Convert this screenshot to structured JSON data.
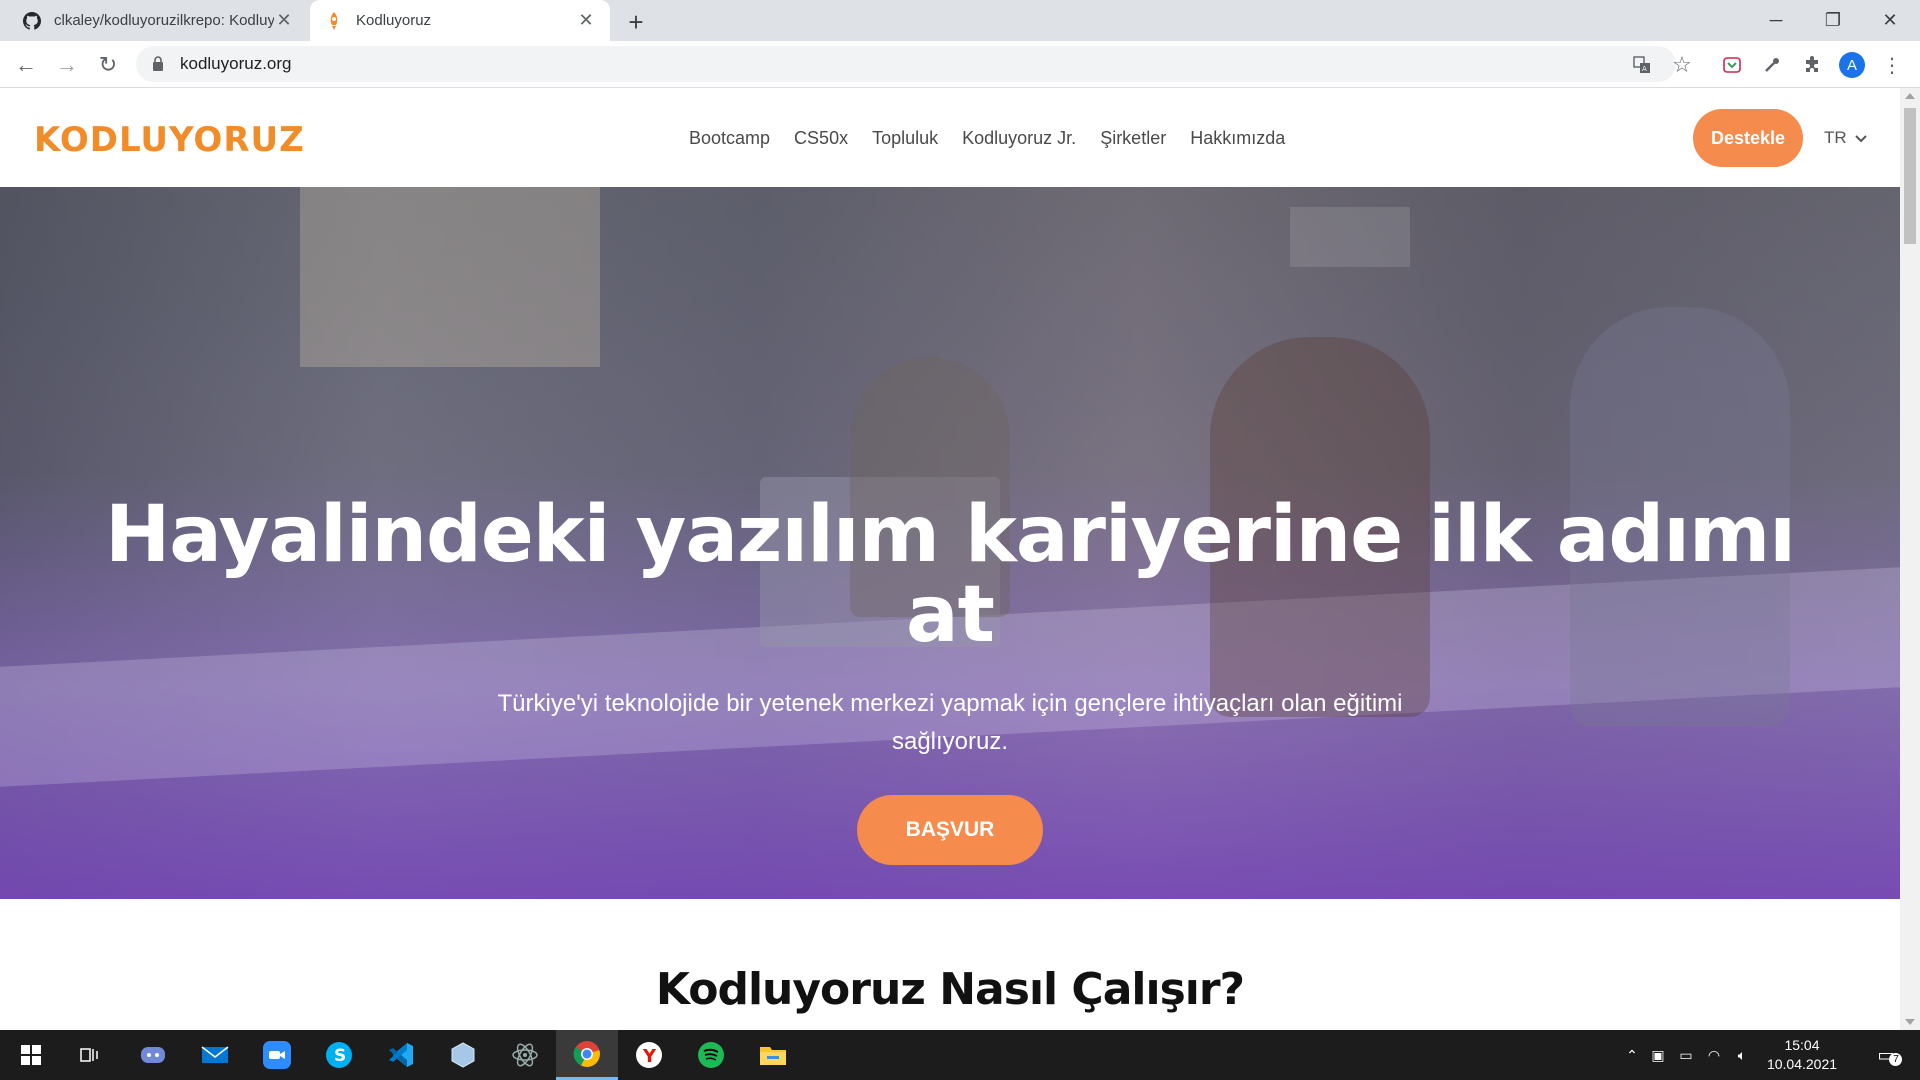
{
  "browser": {
    "tabs": [
      {
        "title": "clkaley/kodluyoruzilkrepo: Kodluy",
        "icon": "github-icon",
        "active": false
      },
      {
        "title": "Kodluyoruz",
        "icon": "kodluyoruz-favicon",
        "active": true
      }
    ],
    "url": "kodluyoruz.org"
  },
  "site": {
    "logo": "KODLUYORUZ",
    "nav": [
      "Bootcamp",
      "CS50x",
      "Topluluk",
      "Kodluyoruz Jr.",
      "Şirketler",
      "Hakkımızda"
    ],
    "support_button": "Destekle",
    "language": "TR",
    "accent_color": "#f58b4c"
  },
  "hero": {
    "title_line1": "Hayalindeki yazılım kariyerine ilk adımı",
    "title_line2": "at",
    "subtitle_line1": "Türkiye'yi teknolojide bir yetenek merkezi yapmak için gençlere ihtiyaçları olan eğitimi",
    "subtitle_line2": "sağlıyoruz.",
    "apply_button": "BAŞVUR"
  },
  "section": {
    "title": "Kodluyoruz Nasıl Çalışır?"
  },
  "taskbar": {
    "time": "15:04",
    "date": "10.04.2021",
    "notification_count": "7"
  }
}
